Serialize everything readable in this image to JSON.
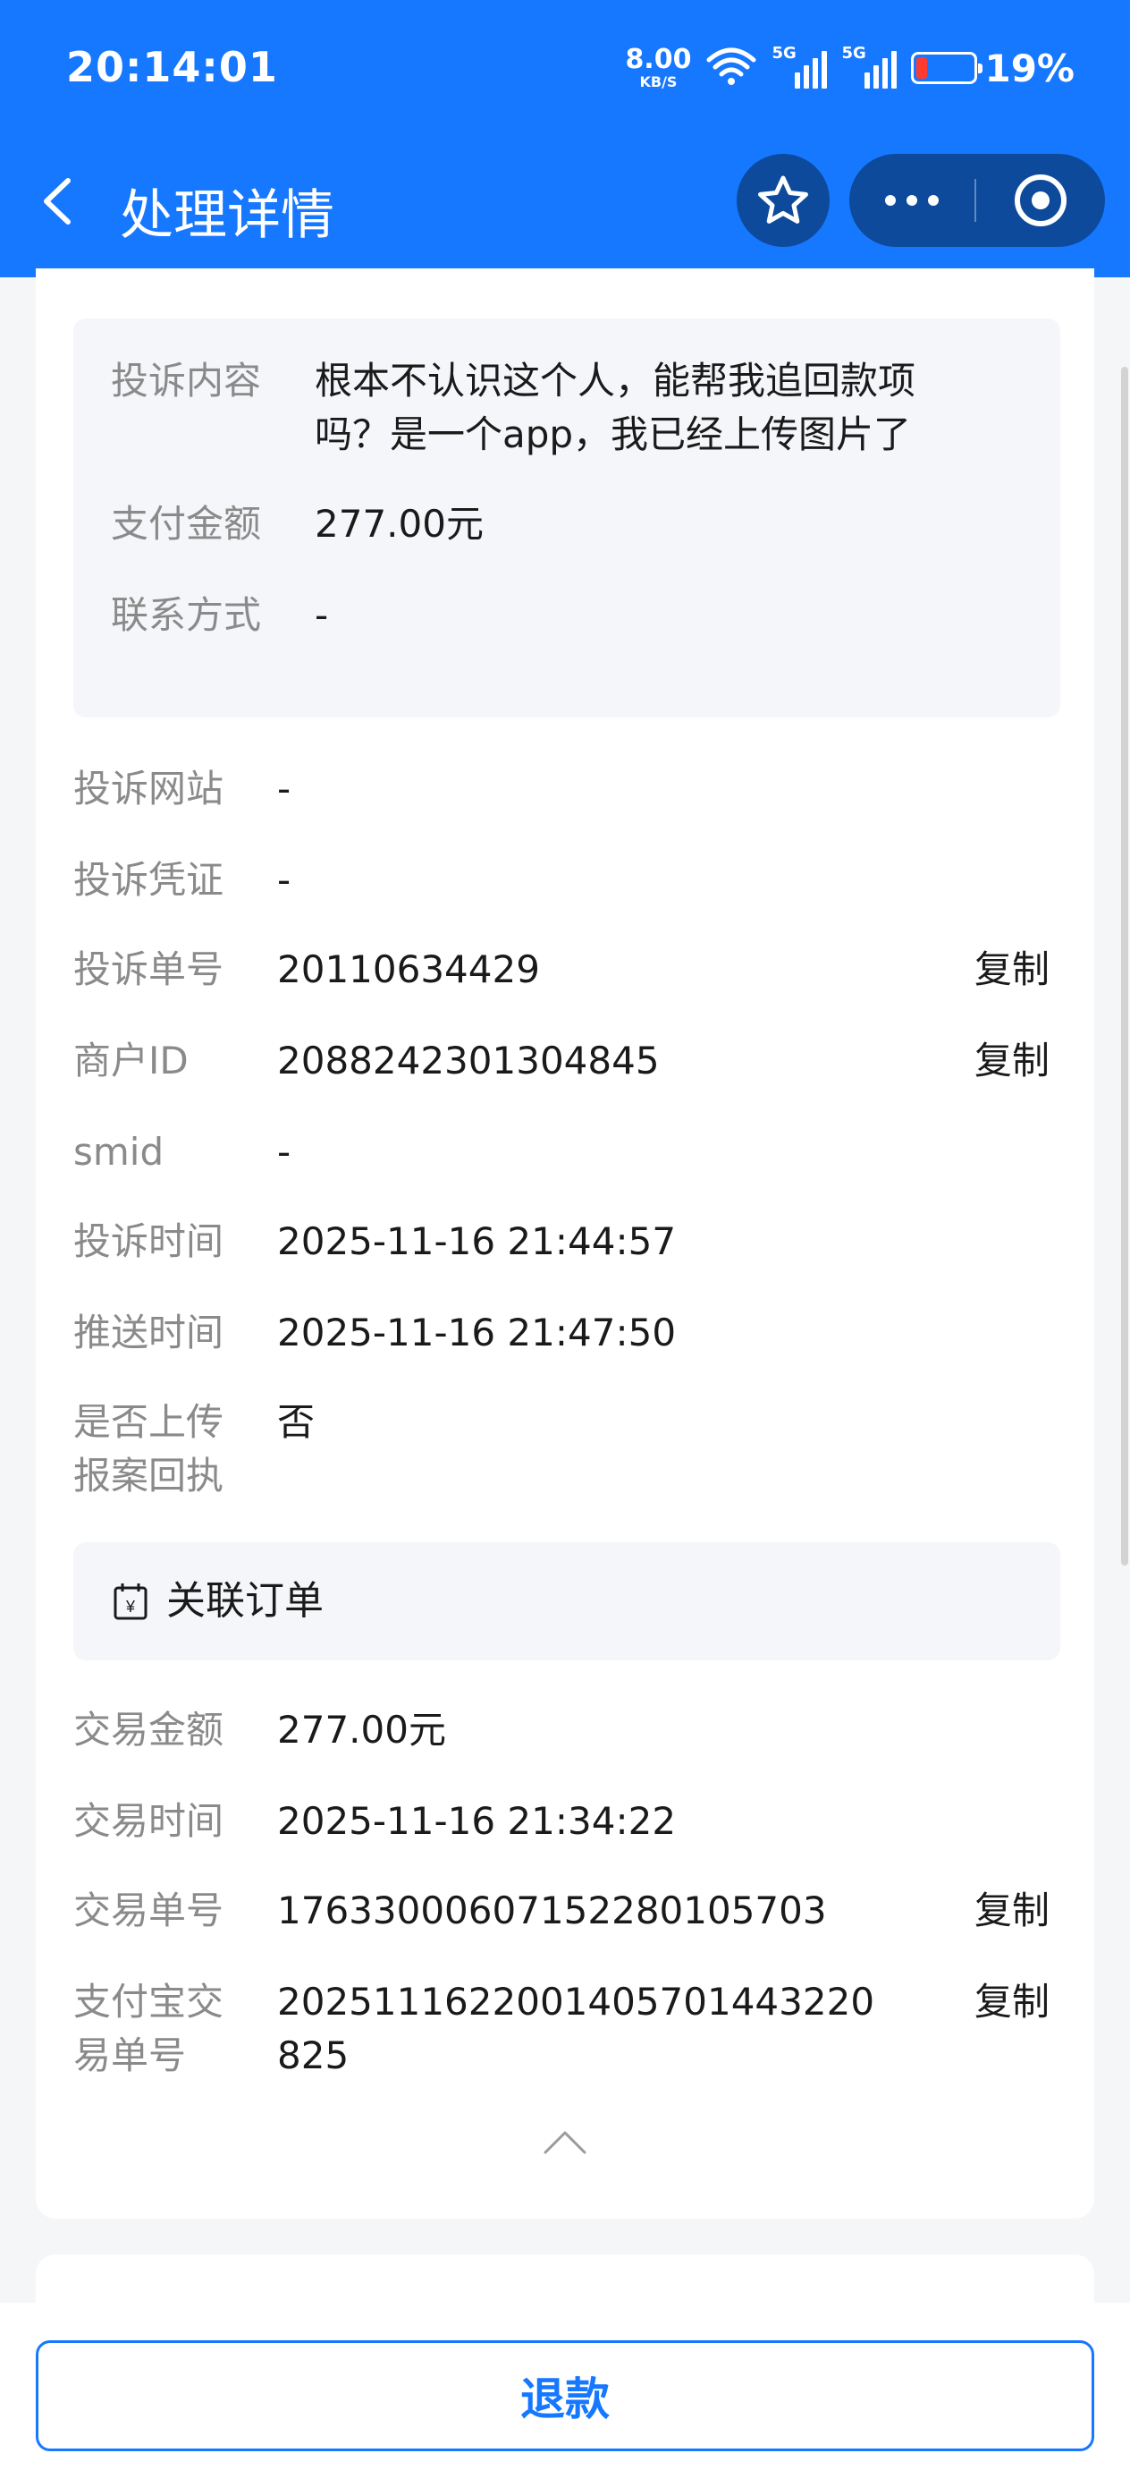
{
  "status_bar": {
    "time": "20:14:01",
    "net_speed_value": "8.00",
    "net_speed_unit": "KB/S",
    "sim1_label": "5G",
    "sim2_label": "5G",
    "battery_percent": "19%",
    "battery_level": 0.19,
    "battery_color": "#ff3b30"
  },
  "nav": {
    "title": "处理详情",
    "back_icon": "chevron-left-icon",
    "favorite_icon": "star-icon",
    "more_icon": "more-dots-icon",
    "close_icon": "target-icon"
  },
  "complaint": {
    "content_label": "投诉内容",
    "content_line1": "根本不认识这个人，能帮我追回款项",
    "content_line2": "吗？是一个app，我已经上传图片了",
    "amount_label": "支付金额",
    "amount_value": "277.00元",
    "contact_label": "联系方式",
    "contact_value": "-"
  },
  "details": {
    "site_label": "投诉网站",
    "site_value": "-",
    "proof_label": "投诉凭证",
    "proof_value": "-",
    "ticket_label": "投诉单号",
    "ticket_value": "20110634429",
    "merchant_label": "商户ID",
    "merchant_value": "2088242301304845",
    "smid_label": "smid",
    "smid_value": "-",
    "complaint_time_label": "投诉时间",
    "complaint_time_value": "2025-11-16 21:44:57",
    "push_time_label": "推送时间",
    "push_time_value": "2025-11-16 21:47:50",
    "upload_label_line1": "是否上传",
    "upload_label_line2": "报案回执",
    "upload_value": "否",
    "copy_label": "复制"
  },
  "order": {
    "section_title": "关联订单",
    "section_icon": "calendar-yuan-icon",
    "amount_label": "交易金额",
    "amount_value": "277.00元",
    "time_label": "交易时间",
    "time_value": "2025-11-16 21:34:22",
    "trade_no_label": "交易单号",
    "trade_no_value": "17633000607152280105703",
    "alipay_label_line1": "支付宝交",
    "alipay_label_line2": "易单号",
    "alipay_value_line1": "2025111622001405701443220",
    "alipay_value_line2": "825"
  },
  "actions": {
    "refund_label": "退款",
    "collapse_icon": "chevron-up-icon"
  },
  "colors": {
    "brand": "#1677ff",
    "nav_button_bg": "#0e4a9c",
    "label_gray": "#8a8a8a",
    "panel_bg": "#f4f6f9"
  }
}
